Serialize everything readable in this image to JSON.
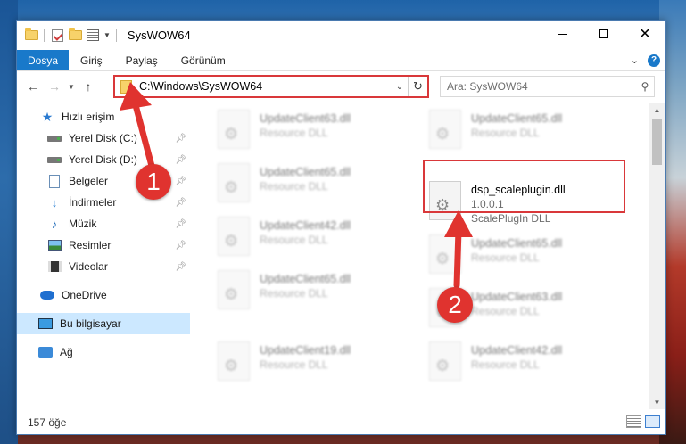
{
  "window": {
    "title": "SysWOW64",
    "tabs": [
      {
        "label": "Dosya"
      },
      {
        "label": "Giriş"
      },
      {
        "label": "Paylaş"
      },
      {
        "label": "Görünüm"
      }
    ]
  },
  "address": {
    "path": "C:\\Windows\\SysWOW64",
    "search_placeholder": "Ara: SysWOW64"
  },
  "navpane": {
    "quick_access": "Hızlı erişim",
    "items": [
      {
        "label": "Yerel Disk (C:)"
      },
      {
        "label": "Yerel Disk (D:)"
      },
      {
        "label": "Belgeler"
      },
      {
        "label": "İndirmeler"
      },
      {
        "label": "Müzik"
      },
      {
        "label": "Resimler"
      },
      {
        "label": "Videolar"
      }
    ],
    "onedrive": "OneDrive",
    "this_pc": "Bu bilgisayar",
    "network": "Ağ"
  },
  "files": [
    {
      "name": "UpdateClient63.dll",
      "type": "Resource DLL"
    },
    {
      "name": "UpdateClient65.dll",
      "type": "Resource DLL"
    },
    {
      "name": "UpdateClient65.dll",
      "type": "Resource DLL"
    },
    {
      "name": "dsp_scaleplugin.dll",
      "version": "1.0.0.1",
      "type": "ScalePlugIn DLL"
    },
    {
      "name": "UpdateClient42.dll",
      "type": "Resource DLL"
    },
    {
      "name": "UpdateClient65.dll",
      "type": "Resource DLL"
    },
    {
      "name": "UpdateClient65.dll",
      "type": "Resource DLL"
    },
    {
      "name": "UpdateClient63.dll",
      "type": "Resource DLL"
    },
    {
      "name": "UpdateClient19.dll",
      "type": "Resource DLL"
    },
    {
      "name": "UpdateClient42.dll",
      "type": "Resource DLL"
    }
  ],
  "status": {
    "item_count": "157 öğe"
  },
  "annotations": {
    "marker1": "1",
    "marker2": "2"
  },
  "colors": {
    "accent": "#1979ca",
    "highlight": "#d9383a",
    "selected": "#cce8ff"
  }
}
